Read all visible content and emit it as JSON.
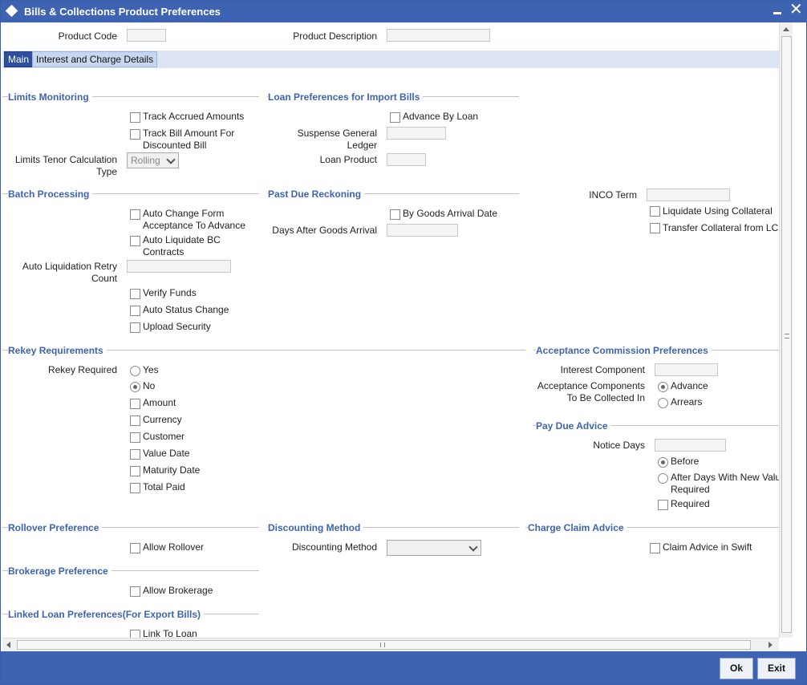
{
  "window": {
    "title": "Bills & Collections Product Preferences"
  },
  "header": {
    "product_code_label": "Product Code",
    "product_code_value": "",
    "product_description_label": "Product Description",
    "product_description_value": ""
  },
  "tabs": [
    {
      "label": "Main"
    },
    {
      "label": "Interest and Charge Details"
    }
  ],
  "limits_monitoring": {
    "title": "Limits Monitoring",
    "track_accrued_amounts": "Track Accrued Amounts",
    "track_bill_amount_l1": "Track Bill Amount For",
    "track_bill_amount_l2": "Discounted Bill",
    "tenor_label_l1": "Limits Tenor Calculation",
    "tenor_label_l2": "Type",
    "tenor_value": "Rolling"
  },
  "loan_import": {
    "title": "Loan Preferences for Import Bills",
    "advance_by_loan": "Advance By Loan",
    "suspense_gl_l1": "Suspense General",
    "suspense_gl_l2": "Ledger",
    "loan_product": "Loan Product"
  },
  "batch": {
    "title": "Batch Processing",
    "auto_change_l1": "Auto Change Form",
    "auto_change_l2": "Acceptance To Advance",
    "auto_liquidate_l1": "Auto Liquidate BC",
    "auto_liquidate_l2": "Contracts",
    "retry_l1": "Auto Liquidation Retry",
    "retry_l2": "Count",
    "verify_funds": "Verify Funds",
    "auto_status_change": "Auto Status Change",
    "upload_security": "Upload Security"
  },
  "past_due": {
    "title": "Past Due Reckoning",
    "by_goods_arrival": "By Goods Arrival Date",
    "days_after": "Days After Goods Arrival"
  },
  "inco": {
    "term_label": "INCO Term",
    "liquidate_collateral": "Liquidate Using Collateral",
    "transfer_collateral": "Transfer Collateral from LC"
  },
  "rekey": {
    "title": "Rekey Requirements",
    "required_label": "Rekey Required",
    "yes": "Yes",
    "no": "No",
    "amount": "Amount",
    "currency": "Currency",
    "customer": "Customer",
    "value_date": "Value Date",
    "maturity_date": "Maturity Date",
    "total_paid": "Total Paid"
  },
  "acceptance": {
    "title": "Acceptance Commission Preferences",
    "interest_component": "Interest Component",
    "components_l1": "Acceptance Components",
    "components_l2": "To Be Collected In",
    "advance": "Advance",
    "arrears": "Arrears"
  },
  "pay_due": {
    "title": "Pay Due Advice",
    "notice_days": "Notice Days",
    "before": "Before",
    "after_l1": "After Days With New Value",
    "after_l2": "Required",
    "required": "Required"
  },
  "rollover": {
    "title": "Rollover Preference",
    "allow": "Allow Rollover"
  },
  "discounting": {
    "title": "Discounting Method",
    "label": "Discounting Method",
    "value": ""
  },
  "charge_claim": {
    "title": "Charge Claim Advice",
    "claim_swift": "Claim Advice in Swift"
  },
  "brokerage": {
    "title": "Brokerage Preference",
    "allow": "Allow Brokerage"
  },
  "linked_loan": {
    "title": "Linked Loan Preferences(For Export Bills)",
    "link": "Link To Loan"
  },
  "footer": {
    "ok": "Ok",
    "exit": "Exit"
  },
  "colors": {
    "title_bar": "#3f63b3",
    "section_title": "#3f63b3",
    "tab_active": "#2c4f9e",
    "tab_strip": "#dde5f5"
  }
}
